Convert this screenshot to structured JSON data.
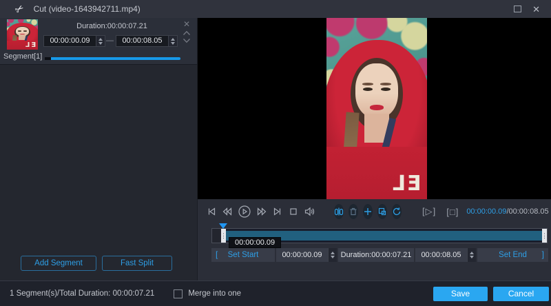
{
  "titlebar": {
    "title": "Cut (video-1643942711.mp4)",
    "close_glyph": "✕"
  },
  "segment_panel": {
    "duration": "Duration:00:00:07.21",
    "start": "00:00:00.09",
    "dash": "—",
    "end": "00:00:08.05",
    "segment_label": "Segment[1]",
    "remove_glyph": "✕",
    "add_button": "Add Segment",
    "fast_split_button": "Fast Split",
    "progress_color": "#1799e9"
  },
  "player": {
    "controls": [
      "previous-frame-icon",
      "rewind-icon",
      "play-icon",
      "fast-forward-icon",
      "next-frame-icon",
      "stop-icon",
      "volume-icon"
    ],
    "tools": [
      "split-icon",
      "delete-icon",
      "add-icon",
      "copy-icon",
      "reset-icon"
    ],
    "bracket_play": "[▷]",
    "bracket_stop": "[□]",
    "current_time": "00:00:00.09",
    "total_time": "/00:00:08.05",
    "playhead_tooltip": "00:00:00.09",
    "video_letters": "EL"
  },
  "trim": {
    "bracket_open": "[",
    "set_start": "Set Start",
    "start": "00:00:00.09",
    "duration": "Duration:00:00:07.21",
    "end": "00:00:08.05",
    "set_end": "Set End",
    "bracket_close": "]"
  },
  "footer": {
    "summary": "1 Segment(s)/Total Duration: 00:00:07.21",
    "merge_label": "Merge into one",
    "merge_checked": false,
    "save": "Save",
    "cancel": "Cancel"
  },
  "colors": {
    "accent": "#2e9fe6",
    "button_blue": "#2aa7f1",
    "timeline_fill": "#21607f",
    "titlebar_bg": "#30333d",
    "panel_bg": "#24272f",
    "footer_bg": "#1f222b"
  }
}
